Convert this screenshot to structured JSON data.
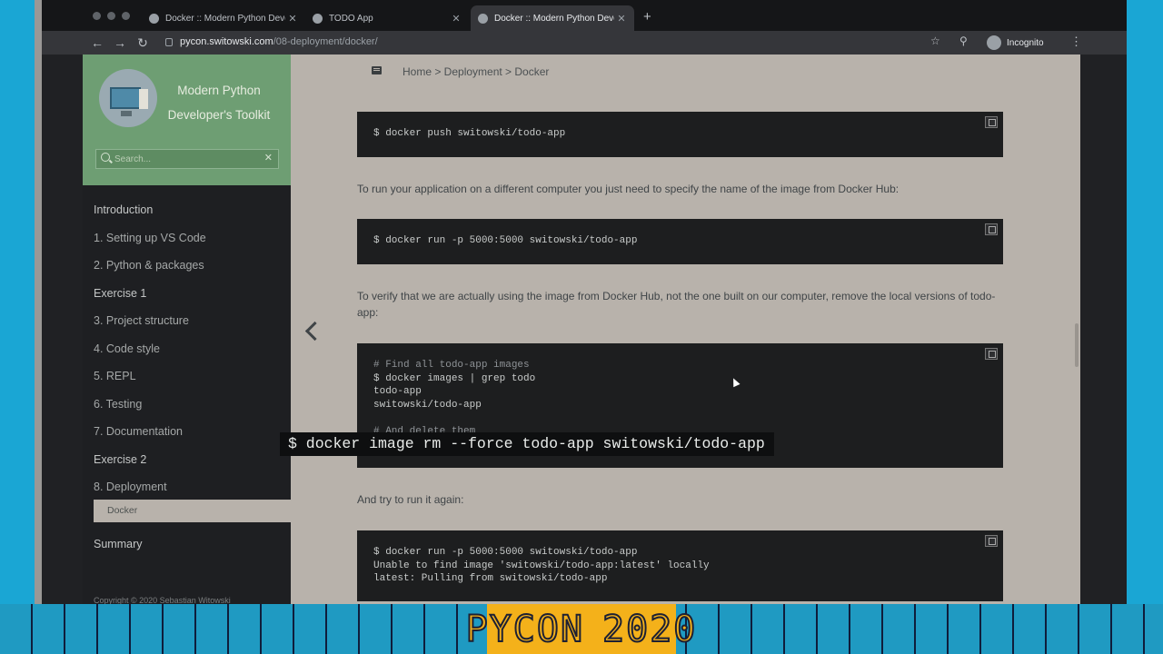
{
  "browser": {
    "tabs": [
      {
        "title": "Docker :: Modern Python Develo",
        "active": false
      },
      {
        "title": "TODO App",
        "active": false
      },
      {
        "title": "Docker :: Modern Python Develo",
        "active": true
      }
    ],
    "new_tab_glyph": "+",
    "url_host": "pycon.switowski.com",
    "url_path": "/08-deployment/docker/",
    "profile_label": "Incognito"
  },
  "sidebar": {
    "title_line1": "Modern Python",
    "title_line2": "Developer's Toolkit",
    "search_placeholder": "Search...",
    "items": [
      {
        "label": "Introduction",
        "top": true
      },
      {
        "label": "1. Setting up VS Code",
        "top": false
      },
      {
        "label": "2. Python & packages",
        "top": false
      },
      {
        "label": "Exercise 1",
        "top": true
      },
      {
        "label": "3. Project structure",
        "top": false
      },
      {
        "label": "4. Code style",
        "top": false
      },
      {
        "label": "5. REPL",
        "top": false
      },
      {
        "label": "6. Testing",
        "top": false
      },
      {
        "label": "7. Documentation",
        "top": false
      },
      {
        "label": "Exercise 2",
        "top": true
      },
      {
        "label": "8. Deployment",
        "top": false
      }
    ],
    "active_sub": "Docker",
    "summary": "Summary",
    "copyright": "Copyright © 2020 Sebastian Witowski"
  },
  "main": {
    "breadcrumb": "Home > Deployment > Docker",
    "block1": [
      "$ docker push switowski/todo-app"
    ],
    "para1": "To run your application on a different computer you just need to specify the name of the image from Docker Hub:",
    "block2": [
      "$ docker run -p 5000:5000 switowski/todo-app"
    ],
    "para2": "To verify that we are actually using the image from Docker Hub, not the one built on our computer, remove the local versions of todo-app:",
    "block3": [
      "# Find all todo-app images",
      "$ docker images | grep todo",
      "todo-app",
      "switowski/todo-app",
      "",
      "# And delete them"
    ],
    "para3": "And try to run it again:",
    "block4": [
      "$ docker run -p 5000:5000 switowski/todo-app",
      "Unable to find image 'switowski/todo-app:latest' locally",
      "latest: Pulling from switowski/todo-app"
    ]
  },
  "overlay": "$ docker image rm --force todo-app switowski/todo-app",
  "banner": {
    "word1": "PYCON",
    "word2": "2020"
  }
}
